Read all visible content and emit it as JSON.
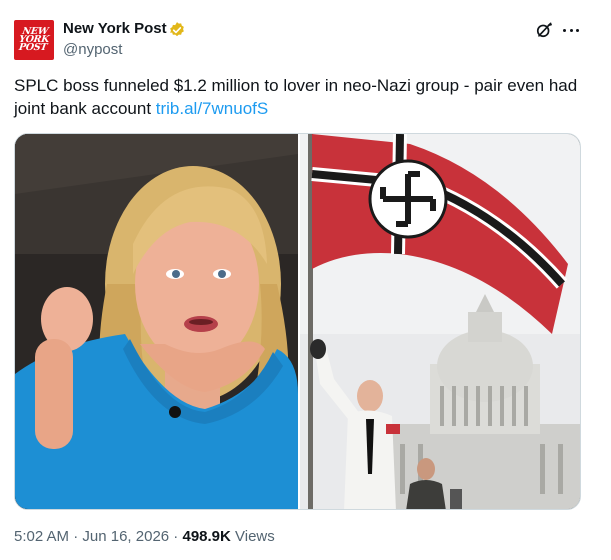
{
  "account": {
    "avatar_text": [
      "NEW",
      "YORK",
      "POST"
    ],
    "display_name": "New York Post",
    "handle": "@nypost",
    "verified_badge": "gold-verified-icon"
  },
  "actions": {
    "grok_icon": "grok-icon",
    "more_icon": "more-options-icon"
  },
  "tweet": {
    "text": "SPLC boss funneled $1.2 million to lover in neo-Nazi group - pair even had joint bank account ",
    "link": "trib.al/7wnuofS"
  },
  "media": {
    "left_photo": "woman-portrait-photo",
    "right_photo": "flag-capitol-photo"
  },
  "meta": {
    "time": "5:02 AM",
    "separator": " · ",
    "date": "Jun 16, 2026",
    "views_count": "498.9K",
    "views_label": " Views"
  },
  "colors": {
    "brand_red": "#d71920",
    "link_blue": "#1d9bf0",
    "muted_gray": "#536471",
    "verified_gold": "#e2b719"
  }
}
